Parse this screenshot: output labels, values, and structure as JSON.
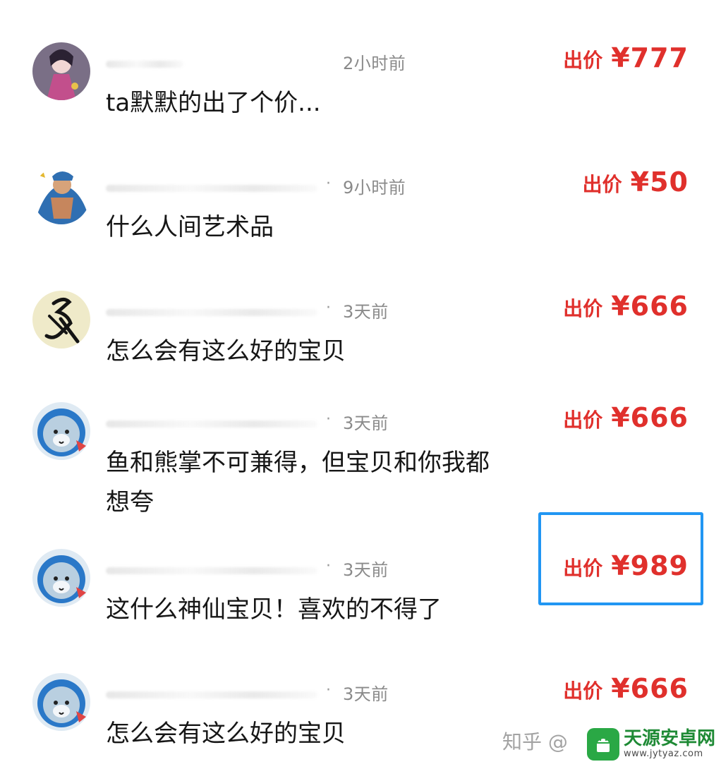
{
  "comments": [
    {
      "time": "2小时前",
      "bid_label": "出价",
      "bid_amount": "¥777",
      "text": "ta默默的出了个价..."
    },
    {
      "time": "9小时前",
      "bid_label": "出价",
      "bid_amount": "¥50",
      "text": "什么人间艺术品"
    },
    {
      "time": "3天前",
      "bid_label": "出价",
      "bid_amount": "¥666",
      "text": "怎么会有这么好的宝贝"
    },
    {
      "time": "3天前",
      "bid_label": "出价",
      "bid_amount": "¥666",
      "text": "鱼和熊掌不可兼得，但宝贝和你我都想夸"
    },
    {
      "time": "3天前",
      "bid_label": "出价",
      "bid_amount": "¥989",
      "text": "这什么神仙宝贝！喜欢的不得了"
    },
    {
      "time": "3天前",
      "bid_label": "出价",
      "bid_amount": "¥666",
      "text": "怎么会有这么好的宝贝"
    }
  ],
  "watermark": "知乎 @",
  "site": {
    "name": "天源安卓网",
    "url": "www.jytyaz.com"
  },
  "colors": {
    "accent": "#e0302c",
    "highlight": "#2196f3",
    "site_green": "#2aa845"
  }
}
